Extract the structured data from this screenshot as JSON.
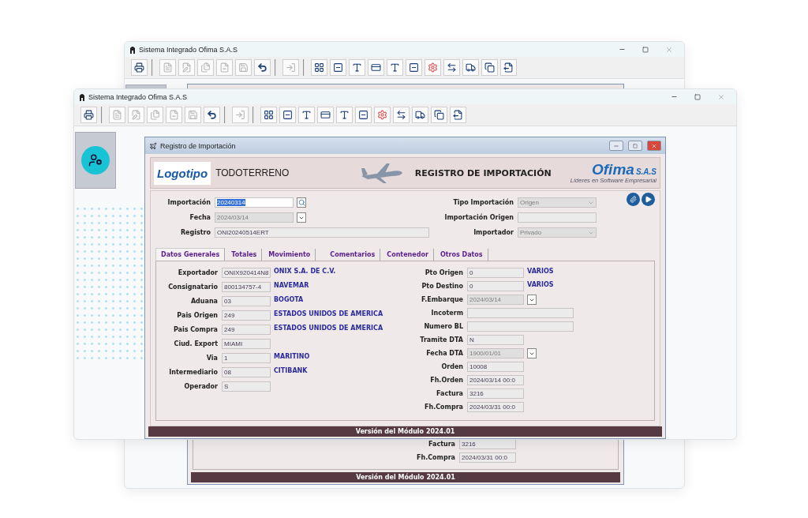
{
  "back_window": {
    "title": "Sistema Integrado Ofima S.A.S",
    "toolbar": [
      [
        {
          "kind": "print",
          "disabled": false
        }
      ],
      [
        {
          "kind": "doc",
          "disabled": true
        },
        {
          "kind": "edit",
          "disabled": true
        },
        {
          "kind": "docs",
          "disabled": true
        },
        {
          "kind": "remove",
          "disabled": true
        },
        {
          "kind": "save",
          "disabled": true
        },
        {
          "kind": "undo",
          "disabled": false
        }
      ],
      [
        {
          "kind": "exit",
          "disabled": true
        }
      ],
      [
        {
          "kind": "grid",
          "disabled": false
        },
        {
          "kind": "form",
          "disabled": false
        },
        {
          "kind": "letter",
          "disabled": false
        },
        {
          "kind": "card",
          "disabled": false
        },
        {
          "kind": "letter",
          "disabled": false
        },
        {
          "kind": "form",
          "disabled": false
        },
        {
          "kind": "gears",
          "disabled": false
        },
        {
          "kind": "swap",
          "disabled": false
        },
        {
          "kind": "truck",
          "disabled": false
        },
        {
          "kind": "copy",
          "disabled": false
        },
        {
          "kind": "export",
          "disabled": false
        }
      ]
    ],
    "fields": [
      {
        "label": "Factura",
        "value": "3216",
        "kind": "text",
        "disabled": false
      },
      {
        "label": "Fh.Compra",
        "value": "2024/03/31 00:0",
        "kind": "text",
        "disabled": false
      }
    ],
    "footer": "Versión del Módulo 2024.01"
  },
  "front_window": {
    "title": "Sistema Integrado Ofima S.A.S",
    "toolbar": [
      [
        {
          "kind": "print",
          "disabled": false
        }
      ],
      [
        {
          "kind": "doc",
          "disabled": true
        },
        {
          "kind": "edit",
          "disabled": true
        },
        {
          "kind": "docs",
          "disabled": true
        },
        {
          "kind": "remove",
          "disabled": true
        },
        {
          "kind": "save",
          "disabled": true
        },
        {
          "kind": "undo",
          "disabled": false
        }
      ],
      [
        {
          "kind": "exit",
          "disabled": true
        }
      ],
      [
        {
          "kind": "grid",
          "disabled": false
        },
        {
          "kind": "form",
          "disabled": false
        },
        {
          "kind": "letter",
          "disabled": false
        },
        {
          "kind": "card",
          "disabled": false
        },
        {
          "kind": "letter",
          "disabled": false
        },
        {
          "kind": "form",
          "disabled": false
        },
        {
          "kind": "gears",
          "disabled": false
        },
        {
          "kind": "swap",
          "disabled": false
        },
        {
          "kind": "truck",
          "disabled": false
        },
        {
          "kind": "copy",
          "disabled": false
        },
        {
          "kind": "export",
          "disabled": false
        }
      ]
    ],
    "child_window": {
      "title": "Registro de Importación",
      "banner": {
        "logo": "Logotipo",
        "company": "TODOTERRENO",
        "heading": "REGISTRO DE IMPORTACIÓN",
        "brand": "Ofima",
        "brand_suffix": "S.A.S",
        "tagline": "Líderes en Software Empresarial"
      },
      "header_left": [
        {
          "label": "Importación",
          "value": "20240314",
          "kind": "search",
          "disabled": false,
          "focused": true
        },
        {
          "label": "Fecha",
          "value": "2024/03/14",
          "kind": "date",
          "disabled": true,
          "focused": false
        },
        {
          "label": "Registro",
          "value": "ONI20240514ERT",
          "kind": "long",
          "disabled": false,
          "focused": false
        }
      ],
      "header_right": [
        {
          "label": "Tipo Importación",
          "value": "Origen",
          "kind": "select",
          "disabled": true
        },
        {
          "label": "Importación Origen",
          "kind": "text",
          "disabled": false
        },
        {
          "label": "Importador",
          "value": "Privado",
          "kind": "select",
          "disabled": true
        }
      ],
      "tabs": [
        {
          "label": "Datos Generales",
          "selected": true
        },
        {
          "label": "Totales",
          "selected": false
        },
        {
          "label": "Movimiento",
          "selected": false
        },
        {
          "label": "Comentarios",
          "selected": false
        },
        {
          "label": "Contenedor",
          "selected": false
        },
        {
          "label": "Otros Datos",
          "selected": false
        }
      ],
      "left_fields": [
        {
          "label": "Exportador",
          "value": "ONIX920414N8",
          "kind": "text",
          "disabled": false,
          "description": "ONIX S.A. DE C.V."
        },
        {
          "label": "Consignatario",
          "value": "800134757-4",
          "kind": "text",
          "disabled": false,
          "description": "NAVEMAR"
        },
        {
          "label": "Aduana",
          "value": "03",
          "kind": "text",
          "disabled": false,
          "description": "BOGOTA"
        },
        {
          "label": "Pais Origen",
          "value": "249",
          "kind": "text",
          "disabled": false,
          "description": "ESTADOS UNIDOS DE AMERICA"
        },
        {
          "label": "Pais Compra",
          "value": "249",
          "kind": "text",
          "disabled": false,
          "description": "ESTADOS UNIDOS DE AMERICA"
        },
        {
          "label": "Ciud. Export",
          "value": "MIAMI",
          "kind": "text",
          "disabled": false
        },
        {
          "label": "Via",
          "value": "1",
          "kind": "text",
          "disabled": false,
          "description": "MARITINO"
        },
        {
          "label": "Intermediario",
          "value": "08",
          "kind": "text",
          "disabled": false,
          "description": "CITIBANK"
        },
        {
          "label": "Operador",
          "value": "S",
          "kind": "text",
          "disabled": false
        }
      ],
      "right_fields": [
        {
          "label": "Pto Origen",
          "value": "0",
          "kind": "text",
          "disabled": false,
          "description": "VARIOS"
        },
        {
          "label": "Pto Destino",
          "value": "0",
          "kind": "text",
          "disabled": false,
          "description": "VARIOS"
        },
        {
          "label": "F.Embarque",
          "value": "2024/03/14",
          "kind": "date",
          "disabled": true
        },
        {
          "label": "Incoterm",
          "kind": "long",
          "disabled": false
        },
        {
          "label": "Numero BL",
          "kind": "long",
          "disabled": false
        },
        {
          "label": "Tramite DTA",
          "value": "N",
          "kind": "text",
          "disabled": false
        },
        {
          "label": "Fecha DTA",
          "value": "1900/01/01",
          "kind": "date",
          "disabled": true
        },
        {
          "label": "Orden",
          "value": "10008",
          "kind": "text",
          "disabled": false
        },
        {
          "label": "Fh.Orden",
          "value": "2024/03/14 00:0",
          "kind": "text",
          "disabled": false
        },
        {
          "label": "Factura",
          "value": "3216",
          "kind": "text",
          "disabled": false
        },
        {
          "label": "Fh.Compra",
          "value": "2024/03/31 00:0",
          "kind": "text",
          "disabled": false
        }
      ],
      "footer": "Versión del Módulo 2024.01"
    }
  }
}
